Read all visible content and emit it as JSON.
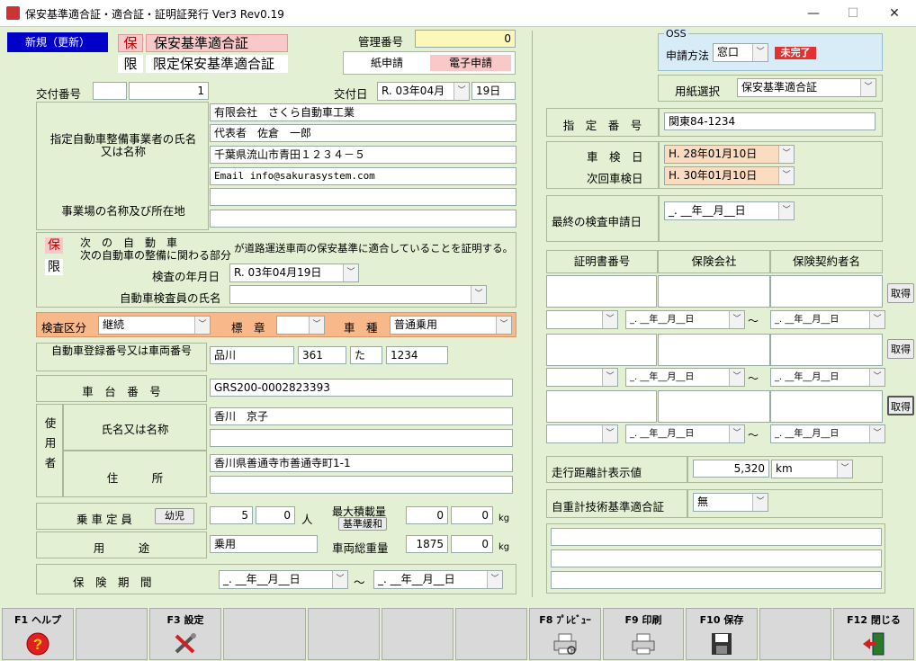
{
  "window": {
    "title": "保安基準適合証・適合証・証明証発行 Ver3 Rev0.19",
    "minimize": "—",
    "maximize": "☐",
    "close": "✕"
  },
  "header": {
    "mode_button": "新規（更新）",
    "cert_main_mark": "保",
    "cert_main_label": "保安基準適合証",
    "cert_limited_mark": "限",
    "cert_limited_label": "限定保安基準適合証",
    "kanri_label": "管理番号",
    "kanri_value": "0",
    "paper_tab": "紙申請",
    "electronic_tab": "電子申請"
  },
  "issue": {
    "number_label": "交付番号",
    "number_prefix": "",
    "number_value": "1",
    "date_label": "交付日",
    "date_value": "R. 03年04月",
    "day_value": "19日"
  },
  "shop": {
    "name_label": "指定自動車整備事業者の氏名又は名称",
    "place_label": "事業場の名称及び所在地",
    "lines": [
      "有限会社　さくら自動車工業",
      "代表者　佐倉　一郎",
      "千葉県流山市青田１２３４－５",
      "Email info@sakurasystem.com",
      "",
      ""
    ]
  },
  "certify": {
    "mark_ho": "保",
    "mark_gen": "限",
    "line1": "次　の　自　動　車",
    "line2": "次の自動車の整備に関わる部分",
    "statement": "が道路運送車両の保安基準に適合していることを証明する。",
    "inspect_date_label": "検査の年月日",
    "inspect_date_value": "R. 03年04月19日",
    "inspector_label": "自動車検査員の氏名",
    "inspector_value": ""
  },
  "kensa": {
    "kubun_label": "検査区分",
    "kubun_value": "継続",
    "hyosho_label": "標　章",
    "hyosho_value": "",
    "shashu_label": "車　種",
    "shashu_value": "普通乗用"
  },
  "vehicle": {
    "reg_label": "自動車登録番号又は車両番号",
    "reg_area": "品川",
    "reg_class": "361",
    "reg_kana": "た",
    "reg_num": "1234",
    "chassis_label": "車　台　番　号",
    "chassis_value": "GRS200-0002823393",
    "user_label": "使用者",
    "user_name_label": "氏名又は名称",
    "user_name": "香川　京子",
    "user_name2": "",
    "user_addr_label": "住　　　所",
    "user_addr": "香川県善通寺市善通寺町1-1",
    "user_addr2": "",
    "capacity_label": "乗 車 定 員",
    "child_button": "幼児",
    "capacity_adult": "5",
    "capacity_child": "0",
    "capacity_unit": "人",
    "max_load_label": "最大積載量",
    "kijun_button": "基準緩和",
    "max_load1": "0",
    "max_load2": "0",
    "kg": "kg",
    "usage_label": "用　　　途",
    "usage_value": "乗用",
    "gross_label": "車両総重量",
    "gross1": "1875",
    "gross2": "0",
    "insurance_label": "保　険　期　間",
    "ins_from": "_. __年__月__日",
    "ins_to": "_. __年__月__日",
    "tilde": "～"
  },
  "right": {
    "oss_title": "OSS",
    "oss_method_label": "申請方法",
    "oss_method": "窓口",
    "oss_status": "未完了",
    "paper_label": "用紙選択",
    "paper_value": "保安基準適合証",
    "shitei_label": "指　定　番　号",
    "shitei_value": "関東84-1234",
    "shaken_label": "車　検　日",
    "shaken_value": "H. 28年01月10日",
    "next_label": "次回車検日",
    "next_value": "H. 30年01月10日",
    "last_label": "最終の検査申請日",
    "last_value": "_. __年__月__日",
    "cols": [
      "証明書番号",
      "保険会社",
      "保険契約者名"
    ],
    "get_button": "取得",
    "empty_date": "_. __年__月__日",
    "odometer_label": "走行距離計表示値",
    "odometer_value": "5,320",
    "odometer_unit": "km",
    "weight_label": "自重計技術基準適合証",
    "weight_value": "無"
  },
  "fkeys": [
    {
      "label": "F1 ヘルプ",
      "icon": "help-icon"
    },
    {
      "label": "",
      "icon": ""
    },
    {
      "label": "F3 設定",
      "icon": "settings-tools-icon"
    },
    {
      "label": "",
      "icon": ""
    },
    {
      "label": "",
      "icon": ""
    },
    {
      "label": "",
      "icon": ""
    },
    {
      "label": "",
      "icon": ""
    },
    {
      "label": "F8 ﾌﾟﾚﾋﾞｭｰ",
      "icon": "printer-preview-icon"
    },
    {
      "label": "F9 印刷",
      "icon": "printer-icon"
    },
    {
      "label": "F10 保存",
      "icon": "floppy-disk-icon"
    },
    {
      "label": "",
      "icon": ""
    },
    {
      "label": "F12 閉じる",
      "icon": "exit-door-icon"
    }
  ]
}
